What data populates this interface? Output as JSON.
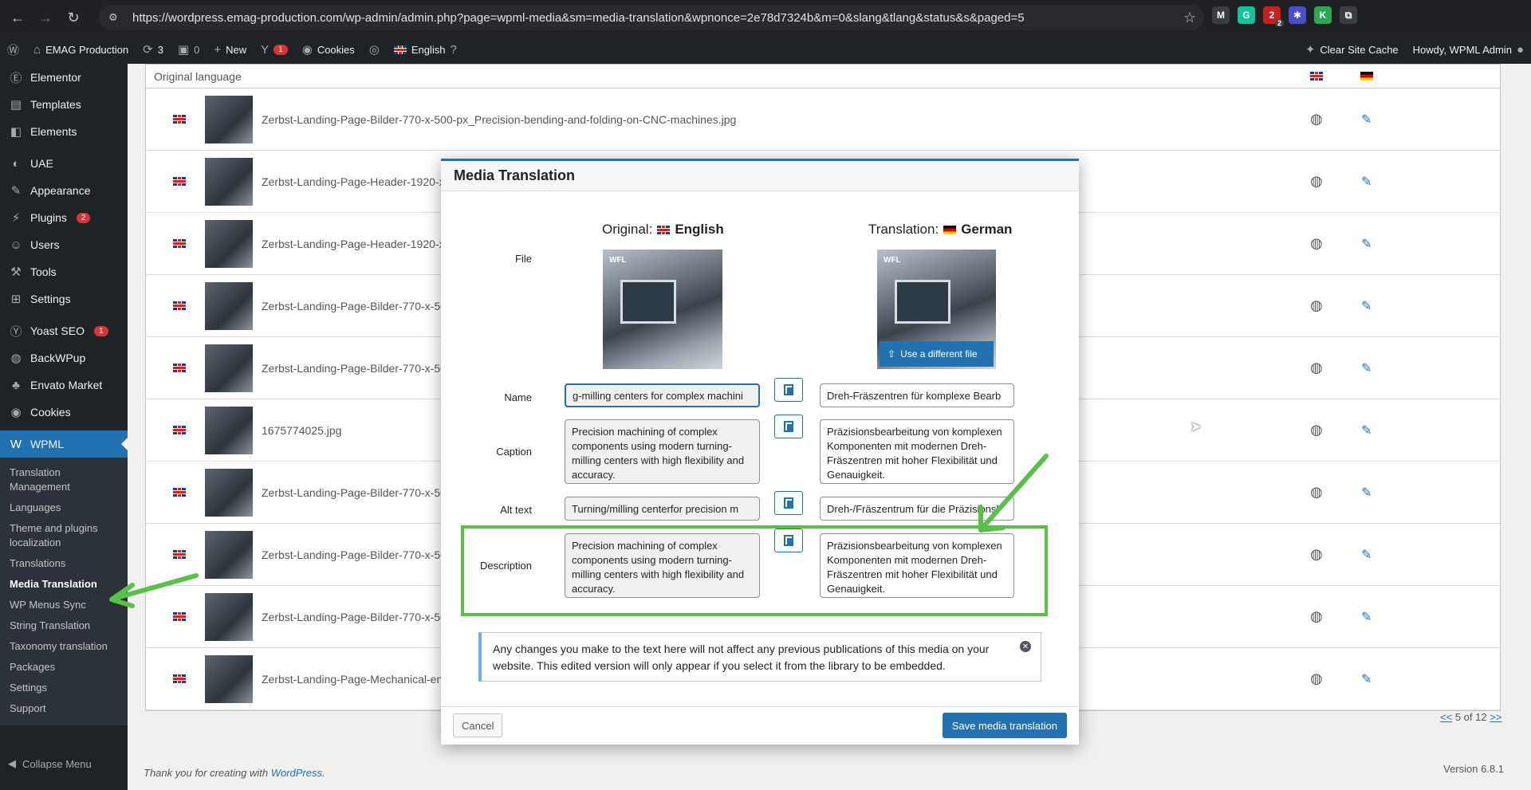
{
  "browser": {
    "url": "https://wordpress.emag-production.com/wp-admin/admin.php?page=wpml-media&sm=media-translation&wpnonce=2e78d7324b&m=0&slang&tlang&status&s&paged=5",
    "extensions": [
      {
        "name": "M",
        "color": "#3a3d41"
      },
      {
        "name": "G",
        "color": "#15c39a"
      },
      {
        "name": "2",
        "color": "#c5221f",
        "badge": "2"
      },
      {
        "name": "✱",
        "color": "#4a4fc9"
      },
      {
        "name": "K",
        "color": "#2ea84f"
      },
      {
        "name": "⧉",
        "color": "#3a3d41"
      }
    ]
  },
  "adminbar": {
    "site_name": "EMAG Production",
    "updates_count": "3",
    "comments_count": "0",
    "new_label": "New",
    "yoast_count": "1",
    "cookies_label": "Cookies",
    "language_label": "English",
    "clear_cache_label": "Clear Site Cache",
    "howdy_label": "Howdy, WPML Admin"
  },
  "sidebar": {
    "items": [
      {
        "label": "Elementor",
        "icon": "elementor-icon"
      },
      {
        "label": "Templates",
        "icon": "folder-icon"
      },
      {
        "label": "Elements",
        "icon": "elements-icon"
      },
      {
        "label": "UAE",
        "icon": "uae-icon"
      },
      {
        "label": "Appearance",
        "icon": "brush-icon"
      },
      {
        "label": "Plugins",
        "icon": "plug-icon",
        "count": "2"
      },
      {
        "label": "Users",
        "icon": "user-icon"
      },
      {
        "label": "Tools",
        "icon": "wrench-icon"
      },
      {
        "label": "Settings",
        "icon": "settings-icon"
      },
      {
        "label": "Yoast SEO",
        "icon": "yoast-icon",
        "count": "1"
      },
      {
        "label": "BackWPup",
        "icon": "backwpup-icon"
      },
      {
        "label": "Envato Market",
        "icon": "envato-icon"
      },
      {
        "label": "Cookies",
        "icon": "cookie-icon"
      },
      {
        "label": "WPML",
        "icon": "wpml-icon",
        "current": true
      }
    ],
    "submenu": [
      "Translation Management",
      "Languages",
      "Theme and plugins localization",
      "Translations",
      "Media Translation",
      "WP Menus Sync",
      "String Translation",
      "Taxonomy translation",
      "Packages",
      "Settings",
      "Support"
    ],
    "current_submenu": "Media Translation",
    "collapse_label": "Collapse Menu"
  },
  "list": {
    "header_label": "Original language",
    "rows": [
      "Zerbst-Landing-Page-Bilder-770-x-500-px_Precision-bending-and-folding-on-CNC-machines.jpg",
      "Zerbst-Landing-Page-Header-1920-x",
      "Zerbst-Landing-Page-Header-1920-x",
      "Zerbst-Landing-Page-Bilder-770-x-50",
      "Zerbst-Landing-Page-Bilder-770-x-50",
      "1675774025.jpg",
      "Zerbst-Landing-Page-Bilder-770-x-50",
      "Zerbst-Landing-Page-Bilder-770-x-50",
      "Zerbst-Landing-Page-Bilder-770-x-50",
      "Zerbst-Landing-Page-Mechanical-en"
    ],
    "pager_prev": "<<",
    "pager_text": "5 of 12",
    "pager_next": ">>"
  },
  "footer": {
    "thanks_text": "Thank you for creating with",
    "wp_link": "WordPress",
    "version": "Version 6.8.1"
  },
  "modal": {
    "title": "Media Translation",
    "original_prefix": "Original:",
    "original_lang": "English",
    "translation_prefix": "Translation:",
    "translation_lang": "German",
    "file_label": "File",
    "brand_text": "WFL",
    "use_different_file": "Use a different file",
    "name_label": "Name",
    "name_original": "g-milling centers for complex machini",
    "name_translation": "Dreh-Fräszentren für komplexe Bearb",
    "caption_label": "Caption",
    "caption_original": "Precision machining of complex components using modern turning-milling centers with high flexibility and accuracy.",
    "caption_translation": "Präzisionsbearbeitung von komplexen Komponenten mit modernen Dreh-Fräszentren mit hoher Flexibilität und Genauigkeit.",
    "alt_label": "Alt text",
    "alt_original": "Turning/milling centerfor precision m",
    "alt_translation": "Dreh-/Fräszentrum für die Präzisionsl",
    "description_label": "Description",
    "description_original": "Precision machining of complex components using modern turning-milling centers with high flexibility and accuracy.",
    "description_translation": "Präzisionsbearbeitung von komplexen Komponenten mit modernen Dreh-Fräszentren mit hoher Flexibilität und Genauigkeit.",
    "notice": "Any changes you make to the text here will not affect any previous publications of this media on your website. This edited version will only appear if you select it from the library to be embedded.",
    "cancel_label": "Cancel",
    "save_label": "Save media translation"
  },
  "colors": {
    "accent": "#2271b1",
    "annotation_green": "#5ac04a",
    "admin_dark": "#1d2327"
  }
}
